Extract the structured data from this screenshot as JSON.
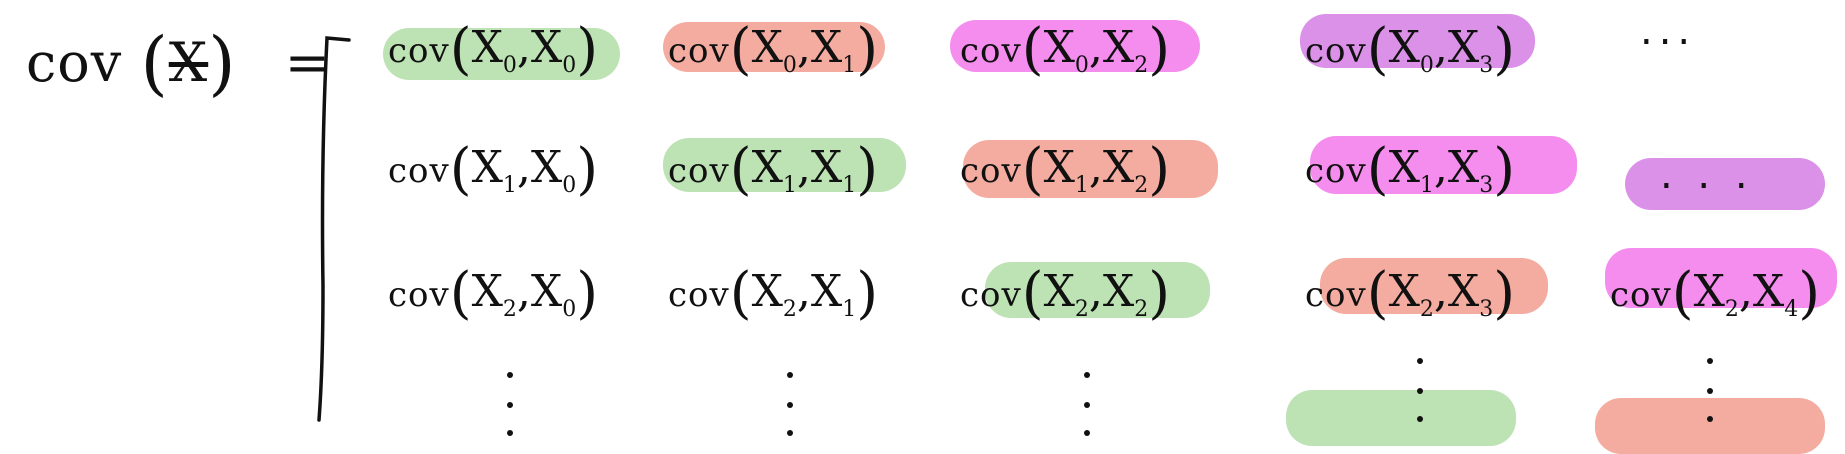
{
  "colors": {
    "green": "#b9e2b0",
    "red": "#f3a89b",
    "pink": "#f487ee",
    "purple": "#d88be6",
    "ink": "#111111"
  },
  "lhs": {
    "fn": "cov",
    "var": "X",
    "equals": "="
  },
  "rows": [
    {
      "cells": [
        {
          "fn": "cov",
          "a": "X",
          "ai": "0",
          "b": "X",
          "bi": "0",
          "color": "green"
        },
        {
          "fn": "cov",
          "a": "X",
          "ai": "0",
          "b": "X",
          "bi": "1",
          "color": "red"
        },
        {
          "fn": "cov",
          "a": "X",
          "ai": "0",
          "b": "X",
          "bi": "2",
          "color": "pink"
        },
        {
          "fn": "cov",
          "a": "X",
          "ai": "0",
          "b": "X",
          "bi": "3",
          "color": "purple"
        }
      ],
      "tail": "..."
    },
    {
      "cells": [
        {
          "fn": "cov",
          "a": "X",
          "ai": "1",
          "b": "X",
          "bi": "0",
          "color": "none"
        },
        {
          "fn": "cov",
          "a": "X",
          "ai": "1",
          "b": "X",
          "bi": "1",
          "color": "green"
        },
        {
          "fn": "cov",
          "a": "X",
          "ai": "1",
          "b": "X",
          "bi": "2",
          "color": "red"
        },
        {
          "fn": "cov",
          "a": "X",
          "ai": "1",
          "b": "X",
          "bi": "3",
          "color": "pink"
        }
      ],
      "tail": ". . ."
    },
    {
      "cells": [
        {
          "fn": "cov",
          "a": "X",
          "ai": "2",
          "b": "X",
          "bi": "0",
          "color": "none"
        },
        {
          "fn": "cov",
          "a": "X",
          "ai": "2",
          "b": "X",
          "bi": "1",
          "color": "none"
        },
        {
          "fn": "cov",
          "a": "X",
          "ai": "2",
          "b": "X",
          "bi": "2",
          "color": "green"
        },
        {
          "fn": "cov",
          "a": "X",
          "ai": "2",
          "b": "X",
          "bi": "3",
          "color": "red"
        },
        {
          "fn": "cov",
          "a": "X",
          "ai": "2",
          "b": "X",
          "bi": "4",
          "color": "pink"
        }
      ]
    }
  ],
  "bottom_dots": [
    {
      "color": "none"
    },
    {
      "color": "none"
    },
    {
      "color": "none"
    },
    {
      "color": "green"
    },
    {
      "color": "red"
    }
  ]
}
